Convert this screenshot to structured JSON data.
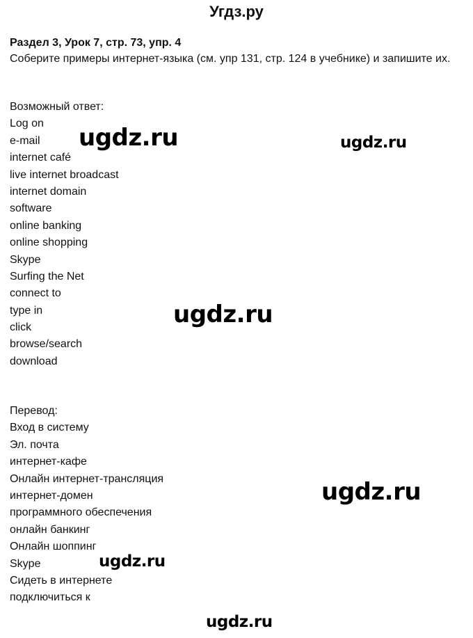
{
  "site_title": "Угдз.ру",
  "heading": "Раздел 3, Урок 7, стр. 73, упр. 4",
  "task": "Соберите примеры интернет-языка (см. упр 131, стр. 124 в учебнике) и запишите их.",
  "answers": {
    "label": "Возможный ответ:",
    "items": [
      "Log on",
      "e-mail",
      "internet café",
      "live internet broadcast",
      "internet domain",
      "software",
      "online banking",
      "online shopping",
      "Skype",
      "Surfing the Net",
      "connect to",
      "type in",
      "click",
      "browse/search",
      "download"
    ]
  },
  "translation": {
    "label": "Перевод:",
    "items": [
      "Вход в систему",
      "Эл. почта",
      "интернет-кафе",
      "Онлайн интернет-трансляция",
      "интернет-домен",
      "программного обеспечения",
      "онлайн банкинг",
      "Онлайн шоппинг",
      "Skype",
      "Сидеть в интернете",
      "подключиться к"
    ]
  },
  "watermarks": [
    "ugdz.ru",
    "ugdz.ru",
    "ugdz.ru",
    "ugdz.ru",
    "ugdz.ru",
    "ugdz.ru"
  ]
}
